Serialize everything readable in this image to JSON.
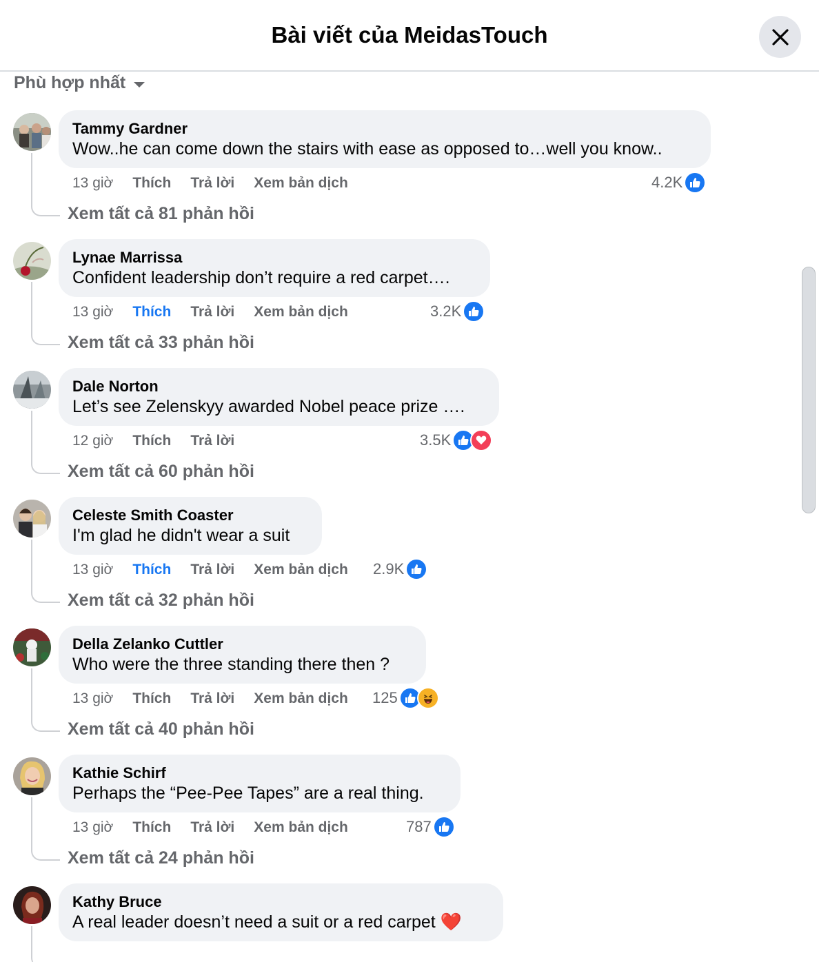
{
  "header": {
    "title": "Bài viết của MeidasTouch"
  },
  "sort": {
    "label": "Phù hợp nhất"
  },
  "actions": {
    "like": "Thích",
    "reply": "Trả lời",
    "translate": "Xem bản dịch"
  },
  "comments": [
    {
      "author": "Tammy Gardner",
      "text": "Wow..he can come down the stairs with ease as opposed to…well you know..",
      "time": "13 giờ",
      "liked": false,
      "reaction_count": "4.2K",
      "reactions": [
        "like"
      ],
      "replies": "Xem tất cả 81 phản hồi"
    },
    {
      "author": "Lynae Marrissa",
      "text": "Confident leadership don’t require a red carpet….",
      "time": "13 giờ",
      "liked": true,
      "reaction_count": "3.2K",
      "reactions": [
        "like"
      ],
      "replies": "Xem tất cả 33 phản hồi"
    },
    {
      "author": "Dale Norton",
      "text": "Let’s see Zelenskyy awarded Nobel peace prize ….",
      "time": "12 giờ",
      "liked": false,
      "reaction_count": "3.5K",
      "reactions": [
        "like",
        "love"
      ],
      "replies": "Xem tất cả 60 phản hồi"
    },
    {
      "author": "Celeste Smith Coaster",
      "text": "I'm glad he didn't wear a suit",
      "time": "13 giờ",
      "liked": true,
      "reaction_count": "2.9K",
      "reactions": [
        "like"
      ],
      "replies": "Xem tất cả 32 phản hồi"
    },
    {
      "author": "Della Zelanko Cuttler",
      "text": "Who were the three standing there then ?",
      "time": "13 giờ",
      "liked": false,
      "reaction_count": "125",
      "reactions": [
        "like",
        "haha"
      ],
      "replies": "Xem tất cả 40 phản hồi"
    },
    {
      "author": "Kathie Schirf",
      "text": "Perhaps the “Pee-Pee Tapes” are a real thing.",
      "time": "13 giờ",
      "liked": false,
      "reaction_count": "787",
      "reactions": [
        "like"
      ],
      "replies": "Xem tất cả 24 phản hồi"
    },
    {
      "author": "Kathy Bruce",
      "text": "A real leader doesn’t need a suit or a red carpet ❤️",
      "time": "",
      "liked": false,
      "reaction_count": "",
      "reactions": [],
      "replies": ""
    }
  ],
  "colors": {
    "like_blue": "#1877f2",
    "love_red": "#f33e58",
    "haha_yellow": "#f7b125",
    "bubble_bg": "#f0f2f5",
    "secondary_text": "#65676b"
  }
}
